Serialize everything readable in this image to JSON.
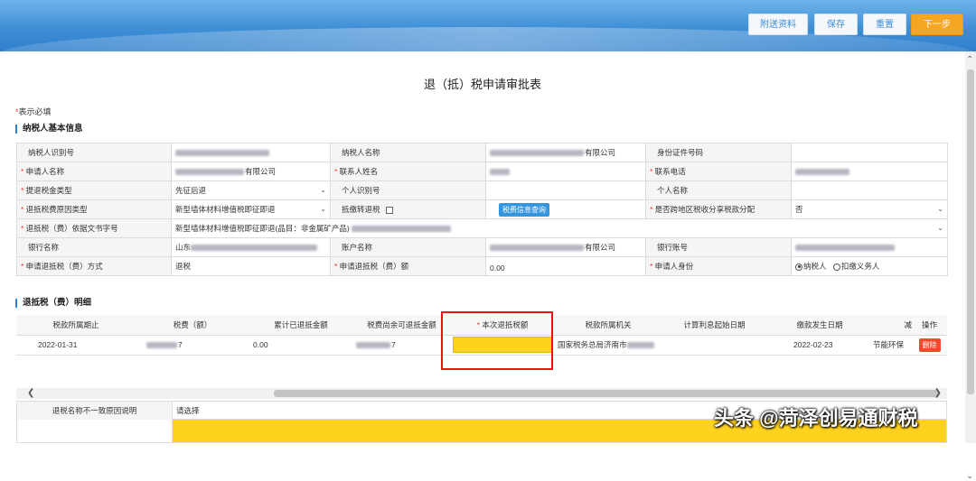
{
  "toolbar": {
    "attach_label": "附送资料",
    "save_label": "保存",
    "reset_label": "重置",
    "next_label": "下一步"
  },
  "page_title": "退（抵）税申请审批表",
  "required_note": {
    "star": "*",
    "text": "表示必填"
  },
  "basic_section": "纳税人基本信息",
  "basic": {
    "taxpayer_id_label": "纳税人识别号",
    "taxpayer_name_label": "纳税人名称",
    "taxpayer_name_suffix": "有限公司",
    "id_type_label": "身份证件号码",
    "applicant_name_label": "申请人名称",
    "applicant_name_suffix": "有限公司",
    "contact_name_label": "联系人姓名",
    "contact_phone_label": "联系电话",
    "refund_type_label": "提退税金类型",
    "refund_type_value": "先征后退",
    "personal_id_label": "个人识别号",
    "personal_name_label": "个人名称",
    "reason_type_label": "退抵税费原因类型",
    "reason_type_value": "新型墙体材料增值税即征即退",
    "offset_label": "抵缴转退税",
    "query_btn": "税费信息查询",
    "cross_region_label": "是否跨地区税收分享税款分配",
    "cross_region_value": "否",
    "basis_label": "退抵税（费）依据文书字号",
    "basis_value": "新型墙体材料增值税即征即退(品目：非金属矿产品)",
    "bank_label": "银行名称",
    "bank_value_prefix": "山东",
    "account_name_label": "账户名称",
    "account_name_suffix": "有限公司",
    "account_no_label": "银行账号",
    "method_label": "申请退抵税（费）方式",
    "method_value": "退税",
    "amount_label": "申请退抵税（费）额",
    "amount_value": "0.00",
    "identity_label": "申请人身份",
    "identity_opt1": "纳税人",
    "identity_opt2": "扣缴义务人"
  },
  "detail_section": "退抵税（费）明细",
  "detail": {
    "headers": [
      "税款所属期止",
      "税费（额）",
      "累计已退抵金额",
      "税费尚余可退抵金额",
      "本次退抵税额",
      "税款所属机关",
      "计算利息起始日期",
      "缴款发生日期",
      "减",
      "操作"
    ],
    "row": {
      "period_end": "2022-01-31",
      "tax_amount_suffix": "7",
      "refunded": "0.00",
      "remaining_suffix": "7",
      "current": "",
      "authority": "国家税务总局济南市",
      "interest_start": "",
      "pay_date": "2022-02-23",
      "reduction": "节能环保",
      "delete": "删除"
    }
  },
  "reason_row": {
    "label": "退税名称不一致原因说明",
    "placeholder": "请选择"
  },
  "watermark": "头条 @菏泽创易通财税"
}
